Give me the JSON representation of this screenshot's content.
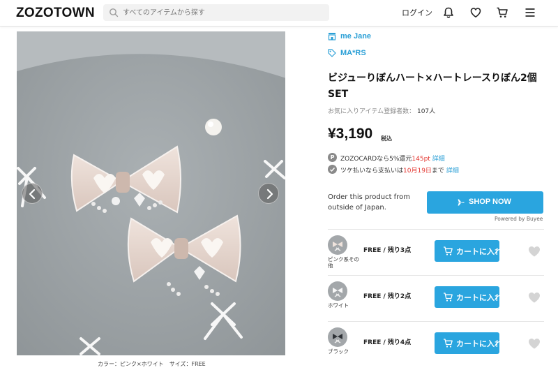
{
  "header": {
    "logo": "ZOZOTOWN",
    "search_placeholder": "すべてのアイテムから探す",
    "login_label": "ログイン",
    "icons": [
      "bell-icon",
      "heart-icon",
      "cart-icon",
      "menu-icon"
    ]
  },
  "gallery": {
    "caption": "カラー：ピンク×ホワイト　サイズ：FREE",
    "background": "#9ea3a6"
  },
  "product": {
    "shop": "me Jane",
    "brand": "MA*RS",
    "title": "ビジューりぼんハート×ハートレースりぼん2個SET",
    "fav_label": "お気に入りアイテム登録者数：",
    "fav_count": "107人",
    "price": "¥3,190",
    "tax_label": "税込",
    "promo1": {
      "badge": "P",
      "pre": "ZOZOCARDなら5%還元",
      "highlight": "145pt",
      "link": "詳細"
    },
    "promo2": {
      "pre": "ツケ払いなら支払いは",
      "highlight": "10月19日",
      "post": "まで",
      "link": "詳細"
    },
    "order_text": "Order this product from outside of Japan.",
    "shop_now": "SHOP NOW",
    "powered_by": "Powered by Buyee"
  },
  "variants": [
    {
      "name": "ピンク系その他",
      "stock": "FREE / 残り3点",
      "cart_label": "カートに入れる"
    },
    {
      "name": "ホワイト",
      "stock": "FREE / 残り2点",
      "cart_label": "カートに入れる"
    },
    {
      "name": "ブラック",
      "stock": "FREE / 残り4点",
      "cart_label": "カートに入れる"
    }
  ],
  "colors": {
    "accent": "#2aa5df",
    "link": "#2a9fd6",
    "highlight": "#e3352f"
  }
}
